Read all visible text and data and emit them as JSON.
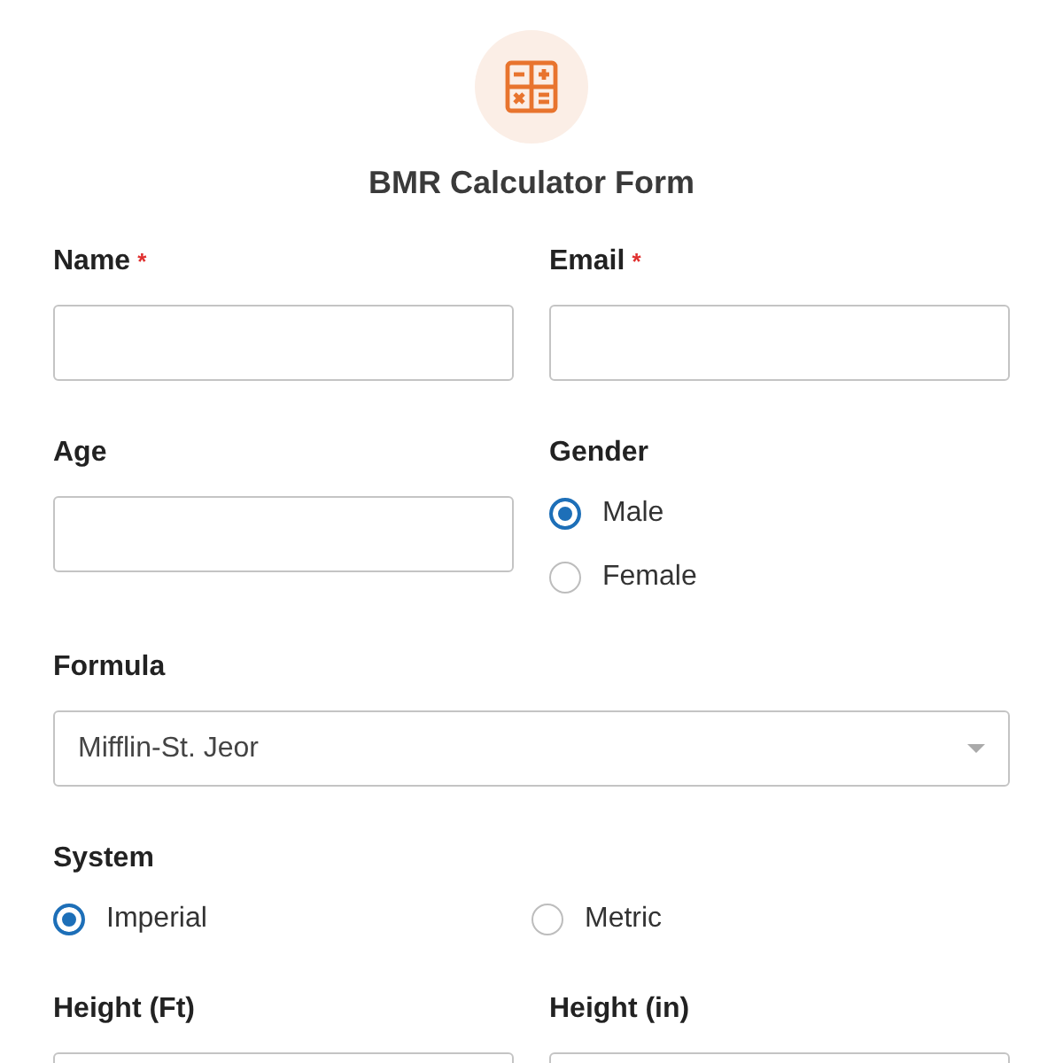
{
  "form": {
    "title": "BMR Calculator Form"
  },
  "rows": [
    {
      "fields": [
        {
          "kind": "text",
          "label": "Name",
          "required_mark": "*"
        },
        {
          "kind": "text",
          "label": "Email",
          "required_mark": "*"
        }
      ]
    },
    {
      "fields": [
        {
          "kind": "text",
          "label": "Age"
        },
        {
          "kind": "radio",
          "label": "Gender",
          "options": [
            {
              "label": "Male",
              "selected": true
            },
            {
              "label": "Female",
              "selected": false
            }
          ]
        }
      ]
    },
    {
      "fields": [
        {
          "kind": "select",
          "label": "Formula",
          "value": "Mifflin-St. Jeor"
        }
      ]
    },
    {
      "fields": [
        {
          "kind": "radio_row",
          "label": "System",
          "options": [
            {
              "label": "Imperial",
              "selected": true
            },
            {
              "label": "Metric",
              "selected": false
            }
          ]
        }
      ]
    },
    {
      "fields": [
        {
          "kind": "text",
          "label": "Height (Ft)"
        },
        {
          "kind": "text",
          "label": "Height (in)"
        }
      ]
    }
  ]
}
